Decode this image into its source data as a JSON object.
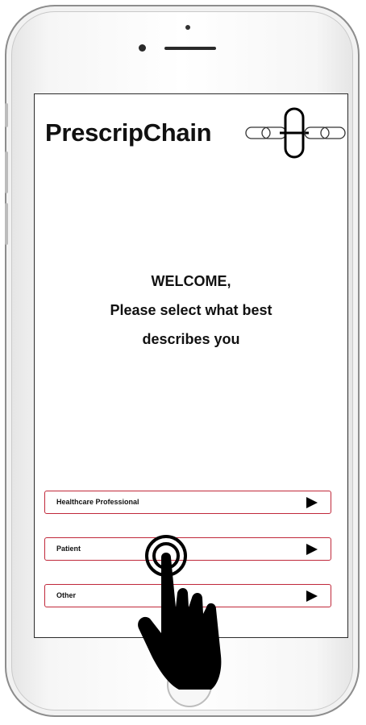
{
  "app": {
    "brand_name": "PrescripChain",
    "logo_icon": "chain-link-icon"
  },
  "welcome": {
    "line1": "WELCOME,",
    "line2": "Please select what best",
    "line3": "describes you"
  },
  "options": [
    {
      "label": "Healthcare Professional",
      "icon": "play-arrow-icon"
    },
    {
      "label": "Patient",
      "icon": "play-arrow-icon"
    },
    {
      "label": "Other",
      "icon": "play-arrow-icon"
    }
  ],
  "overlay": {
    "gesture_icon": "tap-hand-icon"
  },
  "colors": {
    "option_border": "#c0283a",
    "text": "#111111",
    "arrow": "#000000"
  }
}
